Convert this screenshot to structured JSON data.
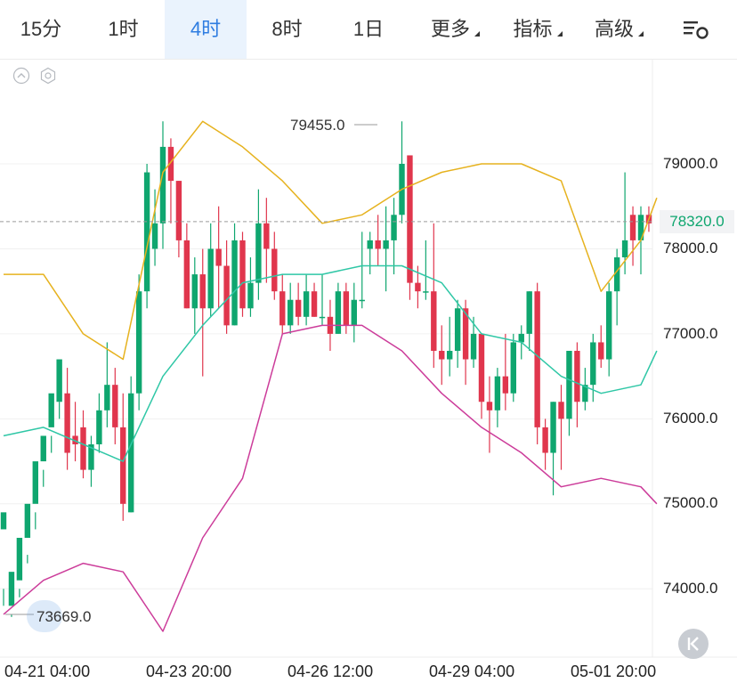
{
  "tabs": [
    {
      "label": "15分",
      "active": false,
      "dropdown": false
    },
    {
      "label": "1时",
      "active": false,
      "dropdown": false
    },
    {
      "label": "4时",
      "active": true,
      "dropdown": false
    },
    {
      "label": "8时",
      "active": false,
      "dropdown": false
    },
    {
      "label": "1日",
      "active": false,
      "dropdown": false
    },
    {
      "label": "更多",
      "active": false,
      "dropdown": true
    },
    {
      "label": "指标",
      "active": false,
      "dropdown": true
    },
    {
      "label": "高级",
      "active": false,
      "dropdown": true
    }
  ],
  "icons": {
    "settings": "settings-icon",
    "collapse": "chevron-up-icon",
    "indicator_settings": "gear-icon",
    "reset": "chevron-left-double-icon"
  },
  "colors": {
    "up": "#0fa66f",
    "down": "#e0364d",
    "boll_upper": "#e6b21e",
    "boll_middle": "#2fc7a6",
    "boll_lower": "#cc3c9a",
    "active_tab": "#2f7de1"
  },
  "chart_data": {
    "type": "candlestick",
    "x_tick_labels": [
      "04-21 04:00",
      "04-23 20:00",
      "04-26 12:00",
      "04-29 04:00",
      "05-01 20:00"
    ],
    "y_tick_labels": [
      "79000.0",
      "78000.0",
      "77000.0",
      "76000.0",
      "75000.0",
      "74000.0"
    ],
    "ylim": [
      73400,
      80200
    ],
    "high_label": "79455.0",
    "low_label": "73669.0",
    "current_price": "78320.0",
    "grid": true,
    "candles": [
      [
        74700,
        74900,
        74000,
        73800
      ],
      [
        73800,
        74200,
        73700,
        73669
      ],
      [
        74100,
        74600,
        73900,
        74000
      ],
      [
        74600,
        75000,
        74400,
        74300
      ],
      [
        75000,
        75500,
        74900,
        74700
      ],
      [
        75500,
        75800,
        75400,
        75200
      ],
      [
        75900,
        76300,
        75800,
        75600
      ],
      [
        76200,
        76700,
        76200,
        76000
      ],
      [
        76300,
        75600,
        76600,
        75400
      ],
      [
        75800,
        75700,
        76200,
        75500
      ],
      [
        75900,
        75400,
        76100,
        75300
      ],
      [
        75400,
        75700,
        75800,
        75200
      ],
      [
        75700,
        76100,
        76300,
        75600
      ],
      [
        76100,
        76400,
        76900,
        75900
      ],
      [
        76400,
        75900,
        76600,
        75700
      ],
      [
        75900,
        75000,
        76300,
        74800
      ],
      [
        74900,
        76300,
        76500,
        74900
      ],
      [
        76300,
        77500,
        77700,
        76100
      ],
      [
        77500,
        78900,
        79000,
        77300
      ],
      [
        78000,
        78300,
        78700,
        77800
      ],
      [
        78300,
        79200,
        79500,
        78000
      ],
      [
        79200,
        78800,
        79300,
        78300
      ],
      [
        78800,
        78100,
        78800,
        77900
      ],
      [
        78100,
        77300,
        78300,
        77300
      ],
      [
        77300,
        77700,
        77900,
        77000
      ],
      [
        77700,
        77300,
        78000,
        76500
      ],
      [
        77300,
        78000,
        78300,
        77200
      ],
      [
        78000,
        77800,
        78500,
        77300
      ],
      [
        77800,
        77100,
        78100,
        77000
      ],
      [
        77100,
        78100,
        78300,
        77100
      ],
      [
        78100,
        77300,
        78200,
        77200
      ],
      [
        77300,
        77600,
        77900,
        77200
      ],
      [
        77600,
        78300,
        78700,
        77400
      ],
      [
        78300,
        78000,
        78600,
        77600
      ],
      [
        78000,
        77500,
        78200,
        77400
      ],
      [
        77500,
        77100,
        77700,
        77000
      ],
      [
        77100,
        77400,
        77600,
        77000
      ],
      [
        77400,
        77200,
        77600,
        77100
      ],
      [
        77200,
        77500,
        77700,
        77100
      ],
      [
        77500,
        77200,
        77600,
        77200
      ],
      [
        77200,
        77200,
        77700,
        77100
      ],
      [
        77200,
        77000,
        77400,
        76800
      ],
      [
        77000,
        77500,
        77600,
        77000
      ],
      [
        77500,
        77100,
        77600,
        77000
      ],
      [
        77100,
        77400,
        77600,
        76900
      ],
      [
        77400,
        77400,
        78200,
        77300
      ],
      [
        78000,
        78100,
        78200,
        77700
      ],
      [
        78100,
        78000,
        78400,
        77800
      ],
      [
        78000,
        78100,
        78500,
        77500
      ],
      [
        78100,
        78400,
        78600,
        77700
      ],
      [
        78400,
        79000,
        79500,
        78300
      ],
      [
        79100,
        77600,
        79000,
        77400
      ],
      [
        77600,
        77500,
        77800,
        77300
      ],
      [
        77500,
        77500,
        78100,
        77400
      ],
      [
        77500,
        76800,
        78300,
        76600
      ],
      [
        76800,
        76700,
        77100,
        76400
      ],
      [
        76700,
        76800,
        77200,
        76500
      ],
      [
        76800,
        77300,
        77400,
        76600
      ],
      [
        77300,
        76700,
        77400,
        76400
      ],
      [
        76700,
        77000,
        77200,
        76600
      ],
      [
        77000,
        76200,
        77000,
        76000
      ],
      [
        76200,
        76100,
        76500,
        75600
      ],
      [
        76100,
        76500,
        76600,
        75900
      ],
      [
        76500,
        76300,
        77000,
        76100
      ],
      [
        76300,
        76900,
        77000,
        76200
      ],
      [
        76900,
        77000,
        77100,
        76700
      ],
      [
        77000,
        77500,
        77500,
        76800
      ],
      [
        77500,
        75900,
        77600,
        75700
      ],
      [
        75900,
        75600,
        76000,
        75400
      ],
      [
        75600,
        76200,
        76200,
        75100
      ],
      [
        76200,
        76000,
        76400,
        75400
      ],
      [
        76000,
        76800,
        76800,
        75800
      ],
      [
        76800,
        76200,
        76900,
        75900
      ],
      [
        76200,
        76400,
        76600,
        76100
      ],
      [
        76400,
        76900,
        77000,
        76200
      ],
      [
        76900,
        76700,
        77100,
        76600
      ],
      [
        76700,
        77500,
        77600,
        76500
      ],
      [
        77500,
        77900,
        78000,
        77100
      ],
      [
        77900,
        78100,
        78900,
        77700
      ],
      [
        78400,
        78100,
        78500,
        77800
      ],
      [
        78100,
        78400,
        78500,
        77700
      ],
      [
        78400,
        78300,
        78500,
        78200
      ]
    ],
    "series": [
      {
        "x_index": [
          0,
          5,
          10,
          15,
          20,
          25,
          30,
          35,
          40,
          45,
          50,
          55,
          60,
          65,
          70,
          75,
          80,
          82
        ],
        "values": [
          77700,
          77700,
          77000,
          76700,
          78900,
          79500,
          79200,
          78800,
          78300,
          78400,
          78700,
          78900,
          79000,
          79000,
          78800,
          77500,
          78100,
          78600
        ]
      },
      {
        "x_index": [
          0,
          5,
          10,
          15,
          20,
          25,
          30,
          35,
          40,
          45,
          50,
          55,
          60,
          65,
          70,
          75,
          80,
          82
        ],
        "values": [
          75800,
          75900,
          75700,
          75500,
          76500,
          77100,
          77600,
          77700,
          77700,
          77800,
          77800,
          77600,
          77000,
          76900,
          76500,
          76300,
          76400,
          76800
        ]
      },
      {
        "x_index": [
          0,
          5,
          10,
          15,
          20,
          25,
          30,
          35,
          40,
          45,
          50,
          55,
          60,
          65,
          70,
          75,
          80,
          82
        ],
        "values": [
          73700,
          74100,
          74300,
          74200,
          73500,
          74600,
          75300,
          77000,
          77100,
          77100,
          76800,
          76300,
          75900,
          75600,
          75200,
          75300,
          75200,
          75000
        ]
      }
    ]
  }
}
